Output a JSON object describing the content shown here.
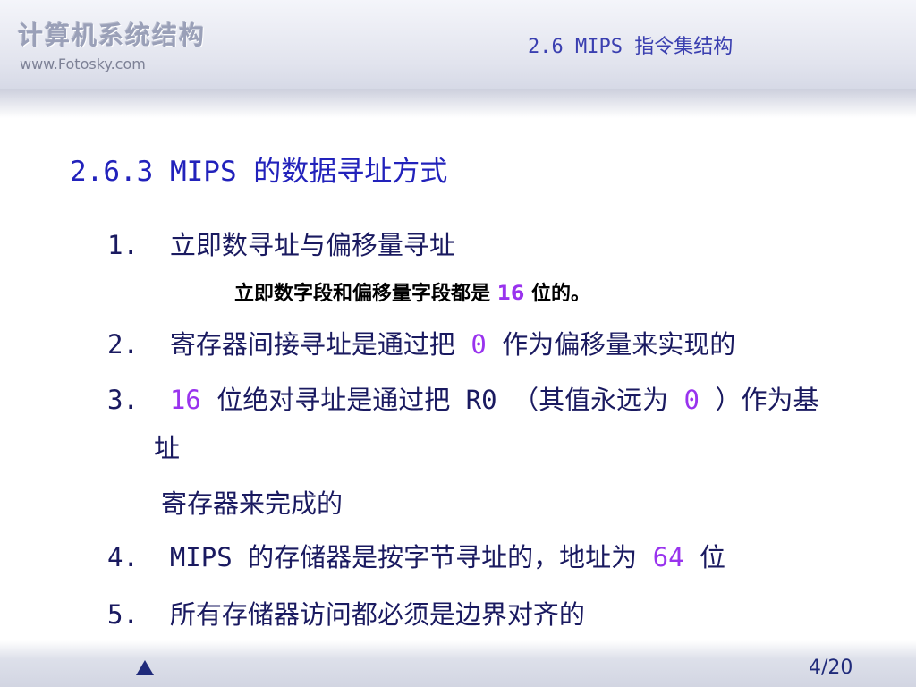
{
  "header": {
    "brand": "计算机系统结构",
    "url": "www.Fotosky.com",
    "section": "2.6 MIPS 指令集结构"
  },
  "main": {
    "title": "2.6.3 MIPS 的数据寻址方式",
    "item1": {
      "num": "1.",
      "text": "立即数寻址与偏移量寻址"
    },
    "note": {
      "pre": "立即数字段和偏移量字段都是 ",
      "hl": "16",
      "post": " 位的。"
    },
    "item2": {
      "num": "2.",
      "pre": "寄存器间接寻址是通过把 ",
      "hl": "0",
      "post": " 作为偏移量来实现的"
    },
    "item3": {
      "num": "3.",
      "hl1": "16",
      "mid": " 位绝对寻址是通过把 R0 （其值永远为 ",
      "hl2": "0",
      "post": " ）作为基",
      "line2": "址",
      "line3": "寄存器来完成的"
    },
    "item4": {
      "num": "4.",
      "pre": "MIPS 的存储器是按字节寻址的，地址为 ",
      "hl": "64",
      "post": " 位"
    },
    "item5": {
      "num": "5.",
      "text": "所有存储器访问都必须是边界对齐的"
    }
  },
  "footer": {
    "up_icon": "triangle-up-icon",
    "page": "4/20"
  },
  "colors": {
    "title": "#2222bb",
    "body": "#1a1a60",
    "highlight": "#9933ee",
    "section": "#3a3fb0"
  }
}
